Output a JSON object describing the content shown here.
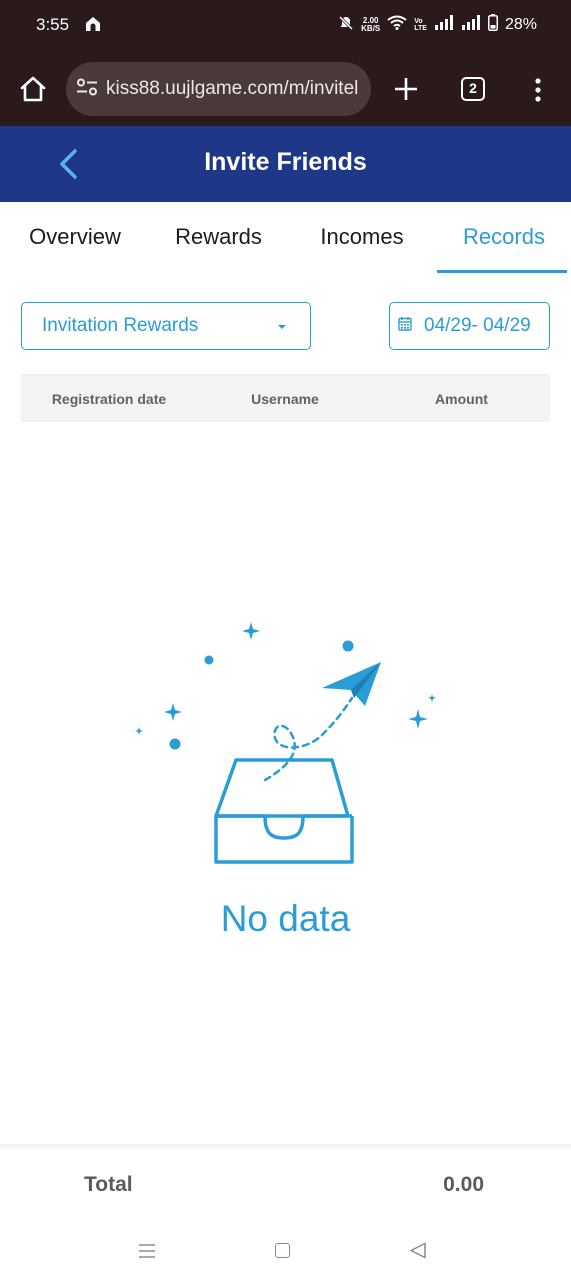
{
  "status_bar": {
    "time": "3:55",
    "speed_top": "2.00",
    "speed_bottom": "KB/S",
    "volte_top": "Vo",
    "volte_bottom": "LTE",
    "battery": "28%"
  },
  "browser": {
    "url": "kiss88.uujlgame.com/m/invitel",
    "tab_count": "2"
  },
  "header": {
    "title": "Invite Friends"
  },
  "tabs": [
    {
      "label": "Overview",
      "active": false
    },
    {
      "label": "Rewards",
      "active": false
    },
    {
      "label": "Incomes",
      "active": false
    },
    {
      "label": "Records",
      "active": true
    }
  ],
  "filters": {
    "type_selected": "Invitation Rewards",
    "date_range": "04/29- 04/29"
  },
  "table": {
    "columns": [
      "Registration date",
      "Username",
      "Amount"
    ]
  },
  "empty_state": {
    "text": "No data"
  },
  "footer": {
    "total_label": "Total",
    "total_value": "0.00"
  },
  "colors": {
    "accent": "#2a9cd6",
    "header_bg": "#1e3786",
    "status_bg": "#2a1a1c"
  }
}
